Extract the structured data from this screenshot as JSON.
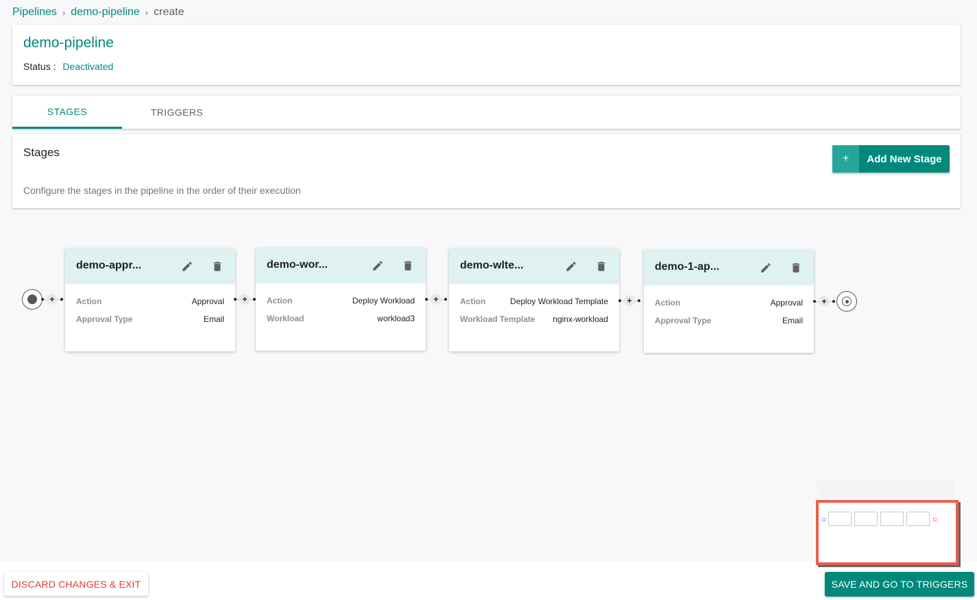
{
  "breadcrumb": {
    "items": [
      "Pipelines",
      "demo-pipeline"
    ],
    "current": "create",
    "separator": "›"
  },
  "pipeline": {
    "title": "demo-pipeline",
    "status_label": "Status :",
    "status_value": "Deactivated"
  },
  "tabs": [
    {
      "label": "STAGES",
      "active": true
    },
    {
      "label": "TRIGGERS",
      "active": false
    }
  ],
  "stages_section": {
    "heading": "Stages",
    "description": "Configure the stages in the pipeline in the order of their execution",
    "add_button_icon": "+",
    "add_button_label": "Add New Stage"
  },
  "connector": {
    "add_icon": "+"
  },
  "stages": [
    {
      "name": "demo-appr...",
      "rows": [
        {
          "key": "Action",
          "value": "Approval"
        },
        {
          "key": "Approval Type",
          "value": "Email"
        }
      ]
    },
    {
      "name": "demo-wor...",
      "rows": [
        {
          "key": "Action",
          "value": "Deploy Workload"
        },
        {
          "key": "Workload",
          "value": "workload3"
        }
      ]
    },
    {
      "name": "demo-wlte...",
      "rows": [
        {
          "key": "Action",
          "value": "Deploy Workload Template"
        },
        {
          "key": "Workload Template",
          "value": "nginx-workload"
        }
      ]
    },
    {
      "name": "demo-1-ap...",
      "rows": [
        {
          "key": "Action",
          "value": "Approval"
        },
        {
          "key": "Approval Type",
          "value": "Email"
        }
      ]
    }
  ],
  "footer": {
    "discard_label": "DISCARD CHANGES & EXIT",
    "save_label": "SAVE AND GO TO TRIGGERS"
  },
  "colors": {
    "accent": "#00897b",
    "danger": "#e53935",
    "stage_header": "#dff2f0",
    "minimap_border": "#e8604f"
  }
}
